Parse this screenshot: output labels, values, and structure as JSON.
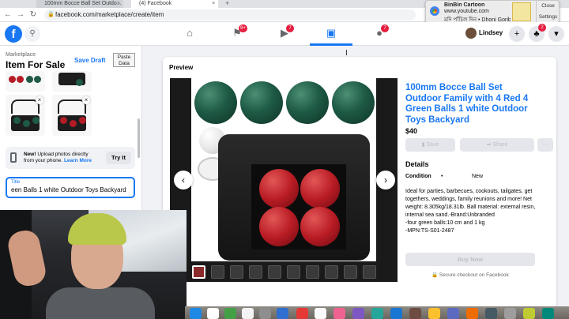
{
  "browser": {
    "tabs": [
      {
        "label": "100mm Bocce Ball Set Outdo..."
      },
      {
        "label": "(4) Facebook"
      }
    ],
    "new_tab": "+",
    "url": "facebook.com/marketplace/create/item"
  },
  "notification": {
    "title": "BinBin Cartoon",
    "source": "www.youtube.com",
    "text": "মদি পাঁচিল দিন • Dhoni Gorib...",
    "close_label": "Close",
    "settings_label": "Settings"
  },
  "fb_nav": {
    "logo": "f",
    "badges": {
      "pages": "9+",
      "watch": "7",
      "groups": "7",
      "notifications": "2"
    },
    "user_name": "Lindsey"
  },
  "left_panel": {
    "marketplace_label": "Marketplace",
    "title": "Item For Sale",
    "save_draft": "Save Draft",
    "paste_data": "Paste Data",
    "upload_notice": {
      "new_label": "New!",
      "text": "Upload photos directly from your phone.",
      "learn_more": "Learn More",
      "try_it": "Try It"
    },
    "title_field": {
      "label": "Title",
      "value": "een Balls 1 white Outdoor Toys Backyard"
    }
  },
  "preview": {
    "label": "Preview",
    "listing_title": "100mm Bocce Ball Set Outdoor Family with 4 Red 4 Green Balls 1 white Outdoor Toys Backyard",
    "price": "$40",
    "save_label": "Save",
    "share_label": "Share",
    "more_label": "···",
    "details_heading": "Details",
    "condition_label": "Condition",
    "condition_separator": "•",
    "condition_value": "New",
    "description": "Ideal for parties, barbecues, cookouts, tailgates, get togethers, weddings, family reunions and more! Net weight: 8.305kg/18.31lb. Ball material: external resin, internal sea sand.-Brand:Unbranded\n-four green balls:10 cm and 1 kg\n-MPN:TS-S01-2487",
    "buy_now": "Buy Now",
    "secure_checkout": "Secure checkout on Facebook"
  },
  "colors": {
    "fb_blue": "#1877f2",
    "badge_red": "#e41e3f",
    "bg_gray": "#f0f2f5"
  },
  "icons": {
    "home": "home-icon",
    "pages": "flag-icon",
    "watch": "play-icon",
    "marketplace": "store-icon",
    "groups": "groups-icon",
    "messenger": "messenger-icon",
    "notifications": "bell-icon",
    "account": "chevron-down-icon",
    "search": "search-icon",
    "phone": "phone-icon",
    "lock": "lock-icon"
  }
}
